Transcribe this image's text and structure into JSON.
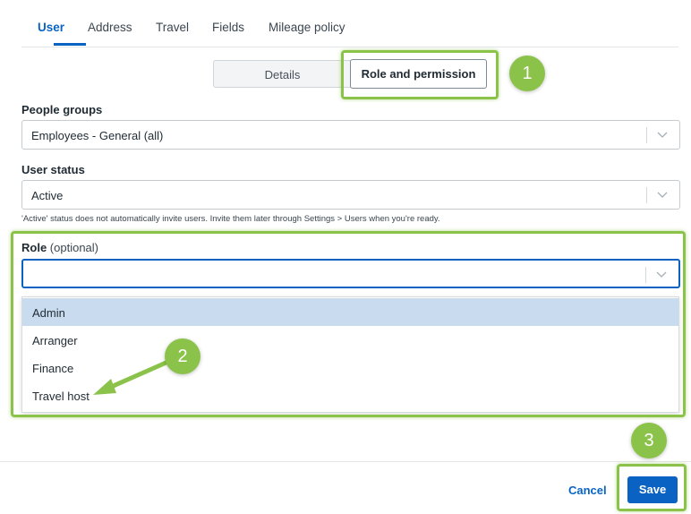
{
  "tabs": [
    {
      "label": "User",
      "active": true
    },
    {
      "label": "Address"
    },
    {
      "label": "Travel"
    },
    {
      "label": "Fields"
    },
    {
      "label": "Mileage policy"
    }
  ],
  "segmented": {
    "details": "Details",
    "role_and_permission": "Role and permission",
    "selected": "Role and permission"
  },
  "people_groups": {
    "label": "People groups",
    "value": "Employees - General (all)"
  },
  "user_status": {
    "label": "User status",
    "value": "Active",
    "hint": "'Active' status does not automatically invite users. Invite them later through Settings > Users when you're ready."
  },
  "role": {
    "label": "Role",
    "optional": "(optional)",
    "value": "",
    "options": [
      "Admin",
      "Arranger",
      "Finance",
      "Travel host"
    ],
    "highlighted": "Admin"
  },
  "footer": {
    "cancel": "Cancel",
    "save": "Save"
  },
  "annotations": {
    "badges": [
      "1",
      "2",
      "3"
    ],
    "color": "#8bc34a"
  },
  "colors": {
    "accent": "#0a63c2",
    "option_highlight": "#c9dcef"
  }
}
